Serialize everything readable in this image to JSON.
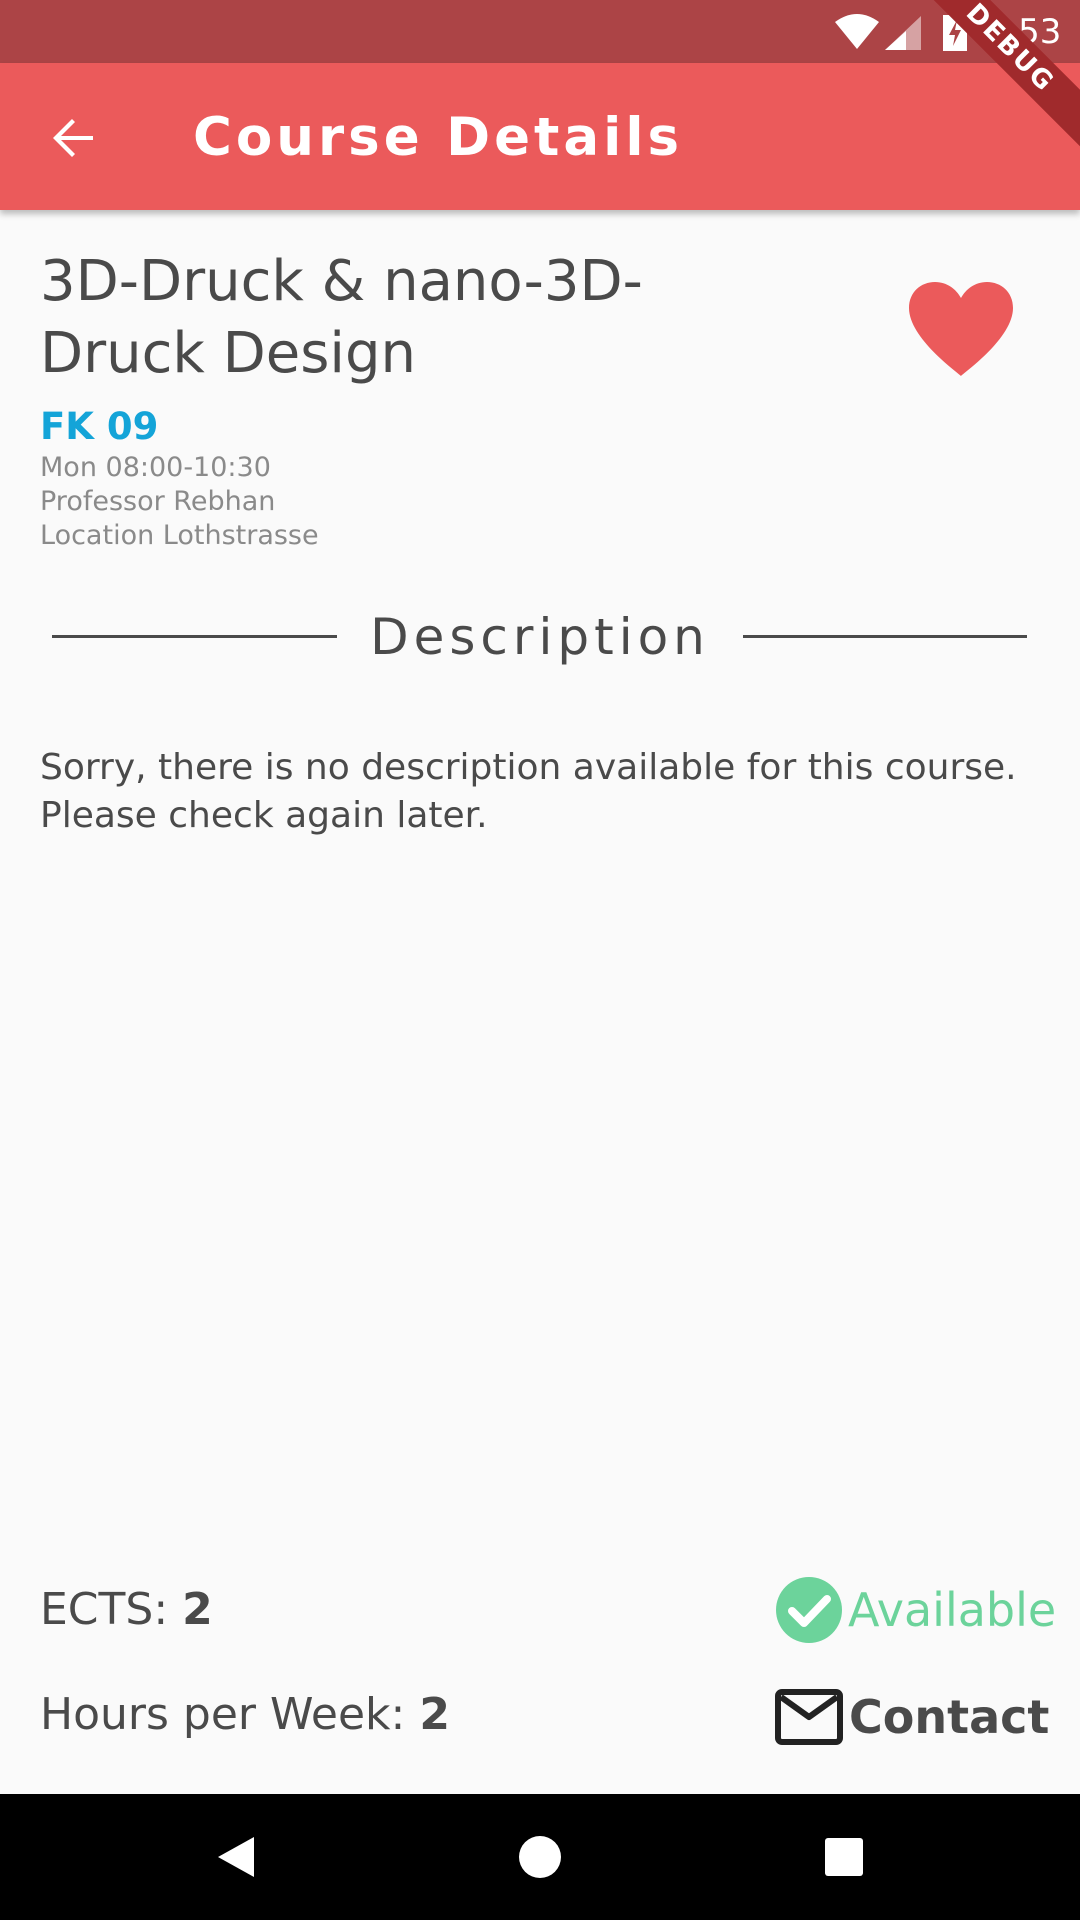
{
  "status_bar": {
    "time": "9:53",
    "icons": [
      "wifi-icon",
      "signal-icon",
      "battery-charging-icon"
    ],
    "color": "#ac4446"
  },
  "debug_banner": "DEBUG",
  "app_bar": {
    "title": "Course Details",
    "back_icon": "arrow-back-icon",
    "color": "#eb5a5b"
  },
  "course": {
    "title": "3D-Druck & nano-3D-Druck Design",
    "favorite": true,
    "favorite_icon": "heart-icon",
    "faculty": "FK 09",
    "time": "Mon 08:00-10:30",
    "professor": "Professor Rebhan",
    "location": "Location Lothstrasse"
  },
  "description": {
    "heading": "Description",
    "text_line1": "Sorry, there is no description available for this course.",
    "text_line2": "Please check again later."
  },
  "info": {
    "ects_label": "ECTS: ",
    "ects_value": "2",
    "hours_label": "Hours per Week: ",
    "hours_value": "2",
    "availability": "Available",
    "availability_icon": "check-circle-icon",
    "availability_color": "#6cd39b",
    "contact": "Contact",
    "contact_icon": "mail-icon"
  },
  "nav_bar": {
    "buttons": [
      "back-triangle-icon",
      "home-circle-icon",
      "recents-square-icon"
    ]
  },
  "colors": {
    "accent": "#eb5a5b",
    "faculty": "#14a4d8",
    "text": "#4a4a4a",
    "meta": "#8a8a8a"
  }
}
